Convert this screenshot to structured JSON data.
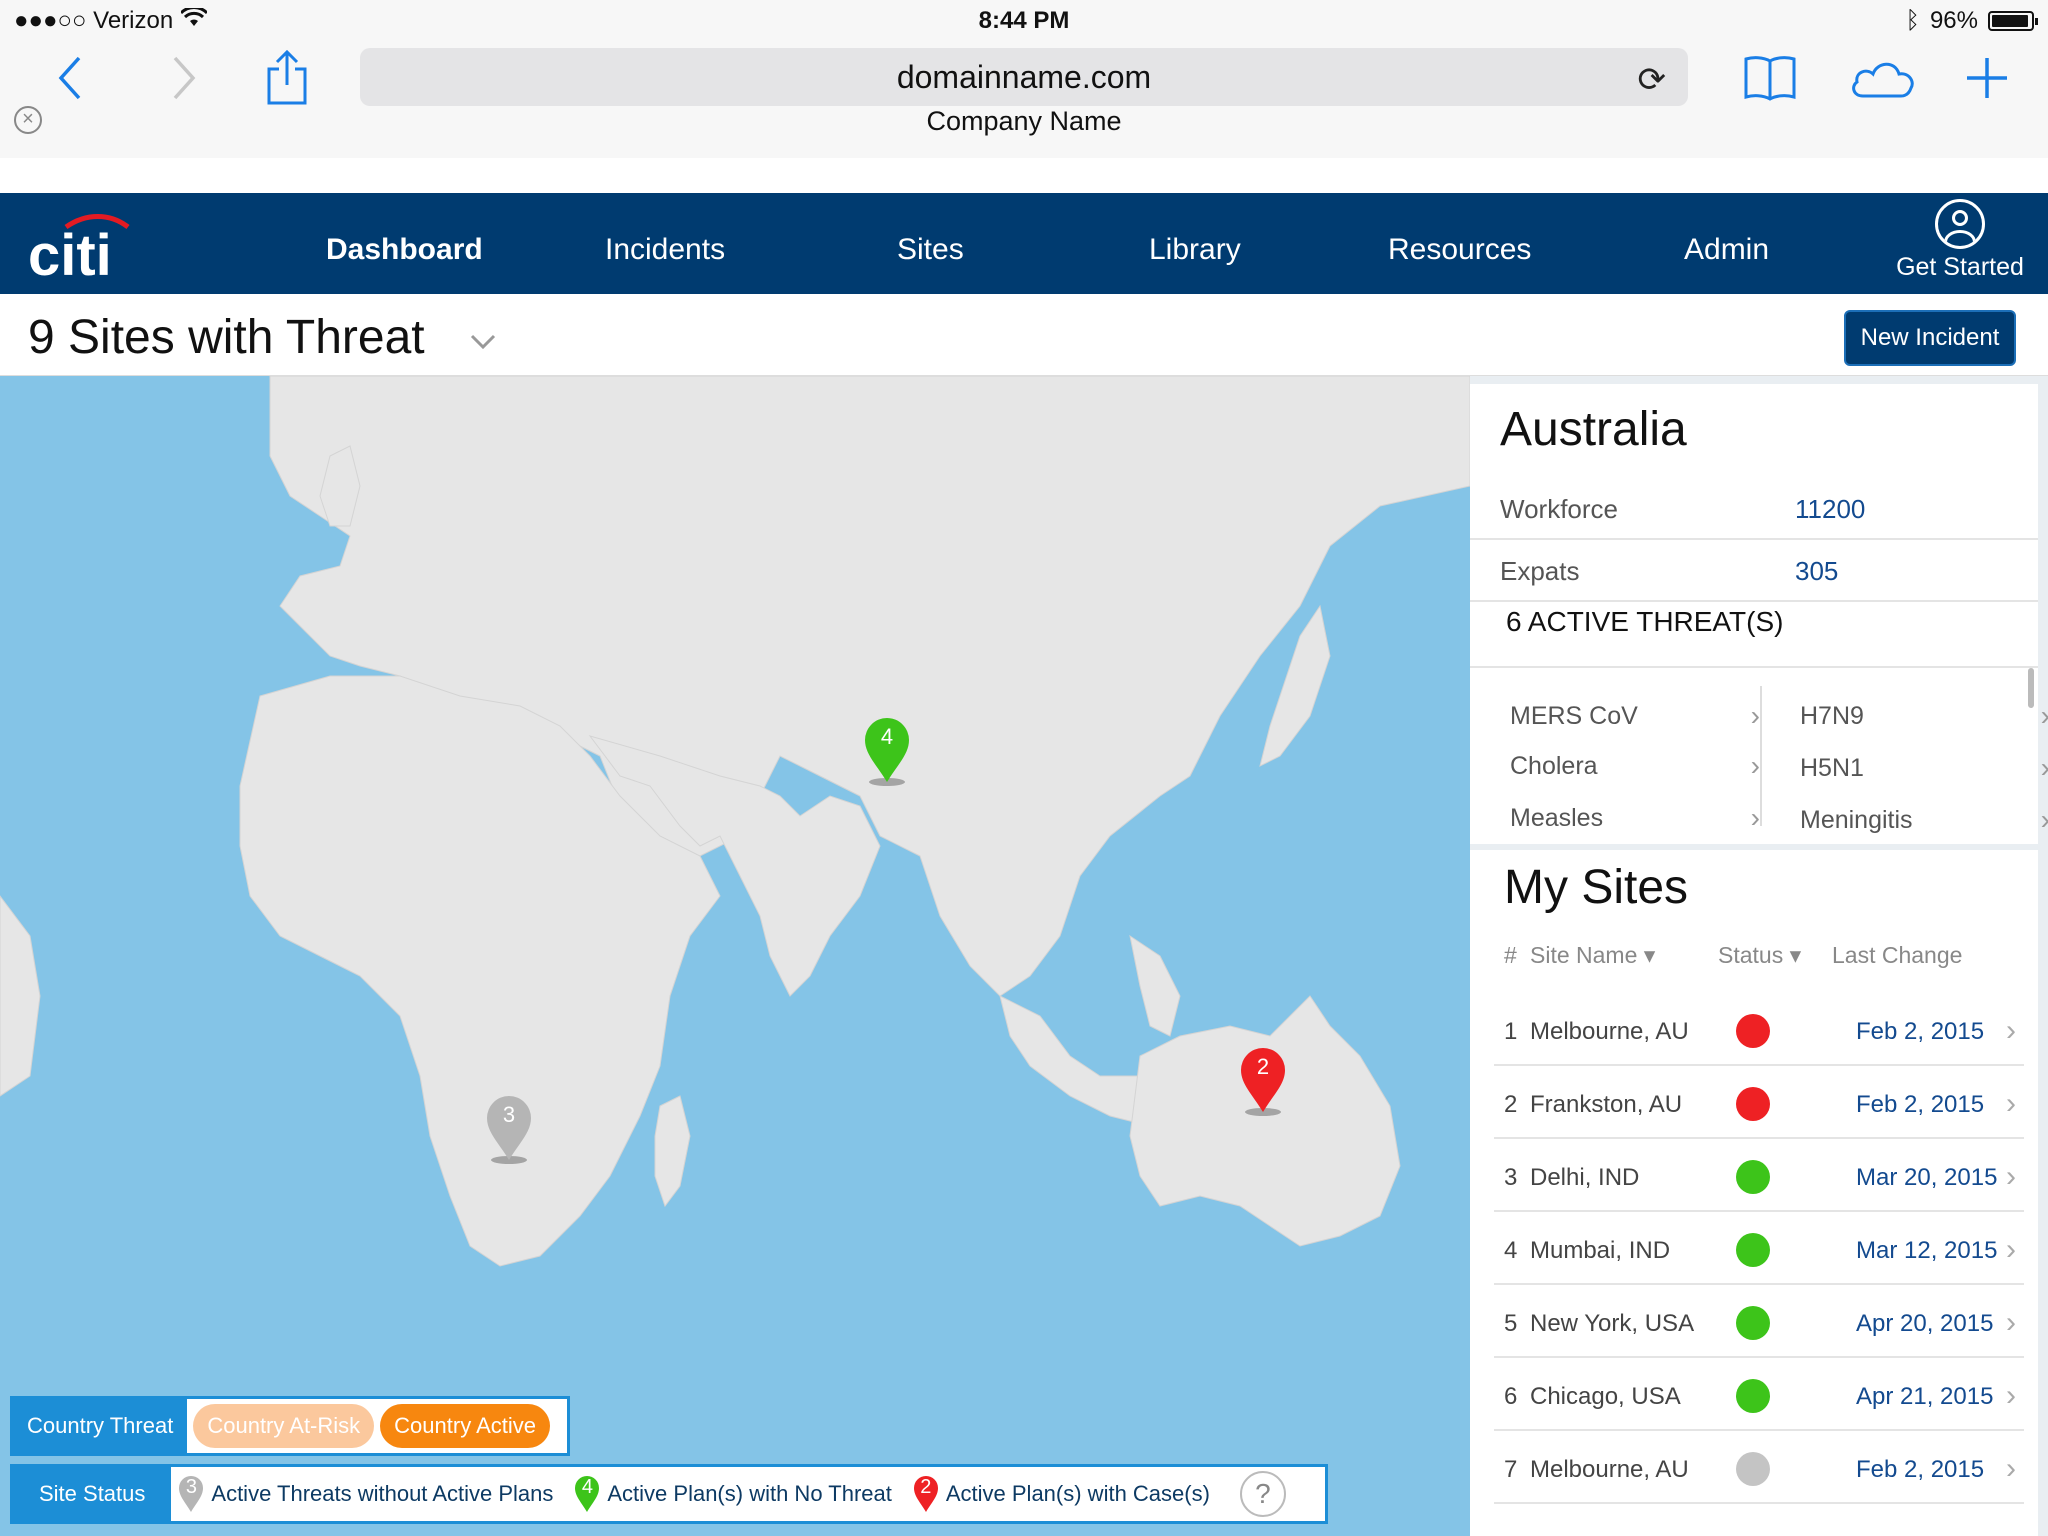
{
  "status_bar": {
    "carrier": "●●●○○ Verizon",
    "time": "8:44 PM",
    "battery": "96%",
    "battery_level": 0.96
  },
  "browser": {
    "url": "domainname.com",
    "tab_title": "Company Name"
  },
  "nav": {
    "logo": "citi",
    "items": [
      {
        "label": "Dashboard",
        "active": true
      },
      {
        "label": "Incidents"
      },
      {
        "label": "Sites"
      },
      {
        "label": "Library"
      },
      {
        "label": "Resources"
      },
      {
        "label": "Admin"
      }
    ],
    "get_started": "Get Started"
  },
  "page": {
    "title": "9 Sites with Threat",
    "new_incident": "New Incident"
  },
  "map": {
    "pins": [
      {
        "label": "4",
        "color": "#3dc41a"
      },
      {
        "label": "3",
        "color": "#b5b5b5"
      },
      {
        "label": "2",
        "color": "#ee2124"
      }
    ],
    "legend": {
      "country_threat": "Country Threat",
      "country_at_risk": "Country At-Risk",
      "country_active": "Country Active",
      "site_status": "Site Status",
      "items": [
        {
          "num": "3",
          "color": "#b5b5b5",
          "label": "Active Threats without Active Plans"
        },
        {
          "num": "4",
          "color": "#3dc41a",
          "label": "Active Plan(s) with No Threat"
        },
        {
          "num": "2",
          "color": "#ee2124",
          "label": "Active Plan(s) with Case(s)"
        }
      ],
      "help": "?"
    }
  },
  "country": {
    "name": "Australia",
    "workforce_label": "Workforce",
    "workforce": "11200",
    "expats_label": "Expats",
    "expats": "305",
    "active_threats": "6 ACTIVE THREAT(S)",
    "threats": [
      "MERS CoV",
      "H7N9",
      "Cholera",
      "H5N1",
      "Measles",
      "Meningitis"
    ]
  },
  "sites": {
    "title": "My Sites",
    "headers": {
      "num": "#",
      "name": "Site Name ▾",
      "status": "Status ▾",
      "last_change": "Last Change"
    },
    "rows": [
      {
        "num": "1",
        "name": "Melbourne, AU",
        "status": "#ee2124",
        "date": "Feb 2, 2015"
      },
      {
        "num": "2",
        "name": "Frankston, AU",
        "status": "#ee2124",
        "date": "Feb 2, 2015"
      },
      {
        "num": "3",
        "name": "Delhi, IND",
        "status": "#3dc41a",
        "date": "Mar 20, 2015"
      },
      {
        "num": "4",
        "name": "Mumbai, IND",
        "status": "#3dc41a",
        "date": "Mar 12, 2015"
      },
      {
        "num": "5",
        "name": "New York, USA",
        "status": "#3dc41a",
        "date": "Apr 20, 2015"
      },
      {
        "num": "6",
        "name": "Chicago, USA",
        "status": "#3dc41a",
        "date": "Apr 21, 2015"
      },
      {
        "num": "7",
        "name": "Melbourne, AU",
        "status": "#c4c4c4",
        "date": "Feb 2, 2015"
      }
    ]
  }
}
